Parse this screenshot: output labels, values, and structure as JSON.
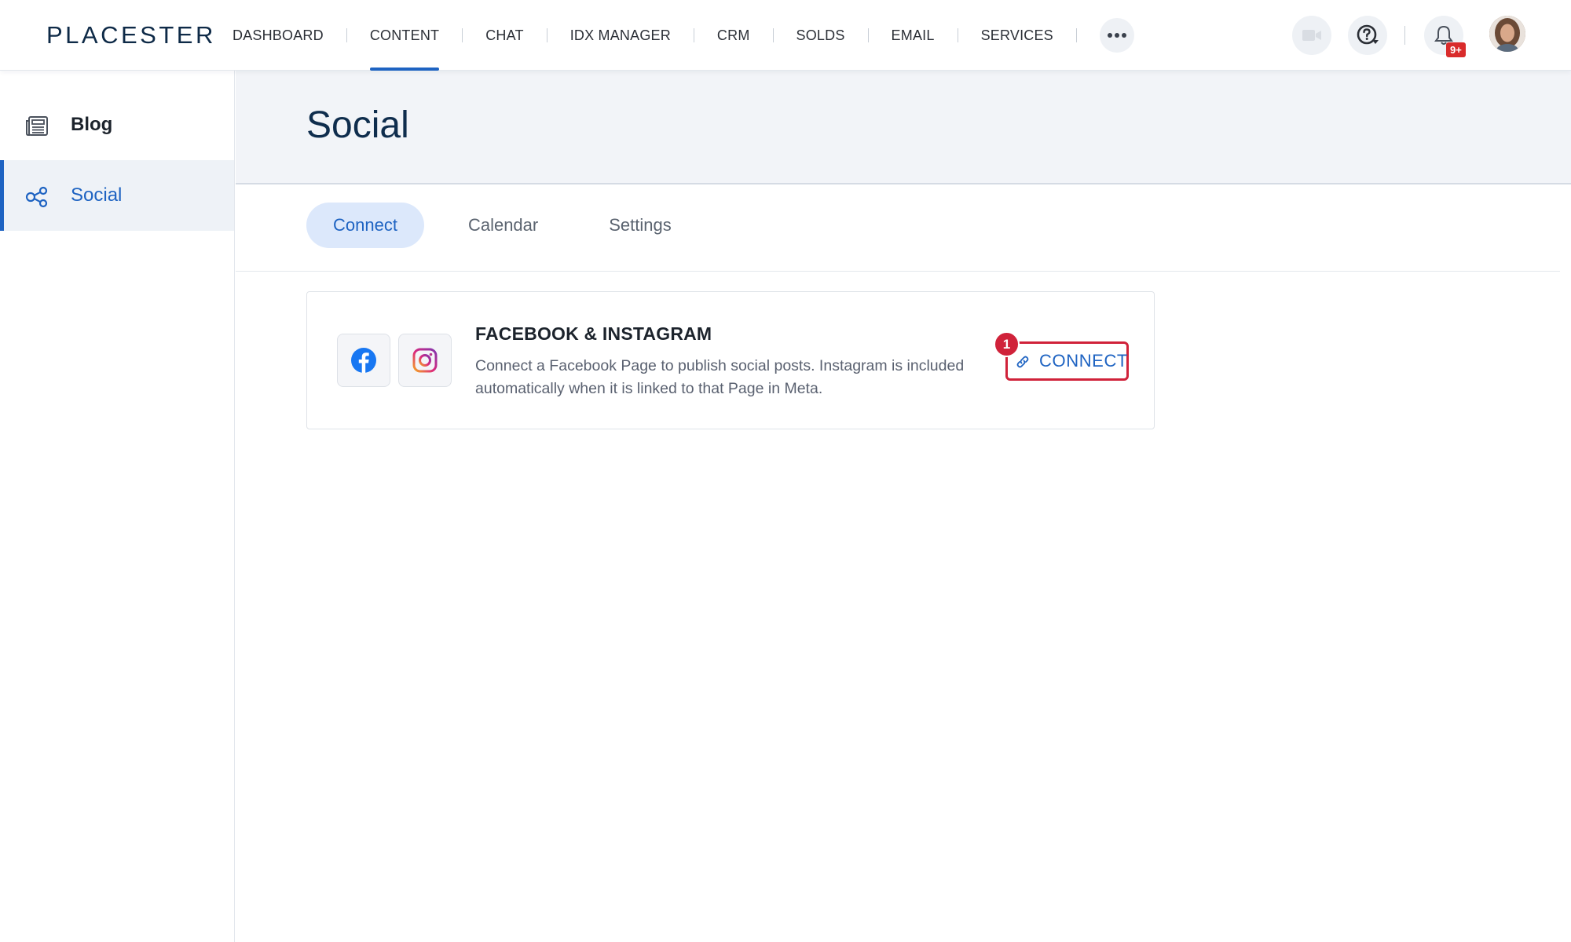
{
  "brand": {
    "logo": "PLACESTER"
  },
  "nav": {
    "items": [
      {
        "label": "DASHBOARD"
      },
      {
        "label": "CONTENT",
        "active": true
      },
      {
        "label": "CHAT"
      },
      {
        "label": "IDX MANAGER"
      },
      {
        "label": "CRM"
      },
      {
        "label": "SOLDS"
      },
      {
        "label": "EMAIL"
      },
      {
        "label": "SERVICES"
      }
    ],
    "more_icon": "ellipsis-icon"
  },
  "header_right": {
    "video_icon": "video-camera-icon",
    "help_icon": "help-circle-icon",
    "notifications_icon": "bell-icon",
    "notifications_badge": "9+"
  },
  "sidebar": {
    "items": [
      {
        "label": "Blog",
        "icon": "newspaper-icon",
        "active": false
      },
      {
        "label": "Social",
        "icon": "share-nodes-icon",
        "active": true
      }
    ]
  },
  "page": {
    "title": "Social"
  },
  "tabs": [
    {
      "label": "Connect",
      "active": true
    },
    {
      "label": "Calendar",
      "active": false
    },
    {
      "label": "Settings",
      "active": false
    }
  ],
  "card": {
    "title": "FACEBOOK & INSTAGRAM",
    "description": "Connect a Facebook Page to publish social posts. Instagram is included automatically when it is linked to that Page in Meta.",
    "button_label": "CONNECT",
    "step_marker": "1",
    "icons": [
      "facebook-icon",
      "instagram-icon"
    ]
  },
  "colors": {
    "accent": "#1e63c2",
    "highlight_red": "#d0223a",
    "nav_text": "#2b2f36",
    "header_bg": "#f2f4f8"
  }
}
